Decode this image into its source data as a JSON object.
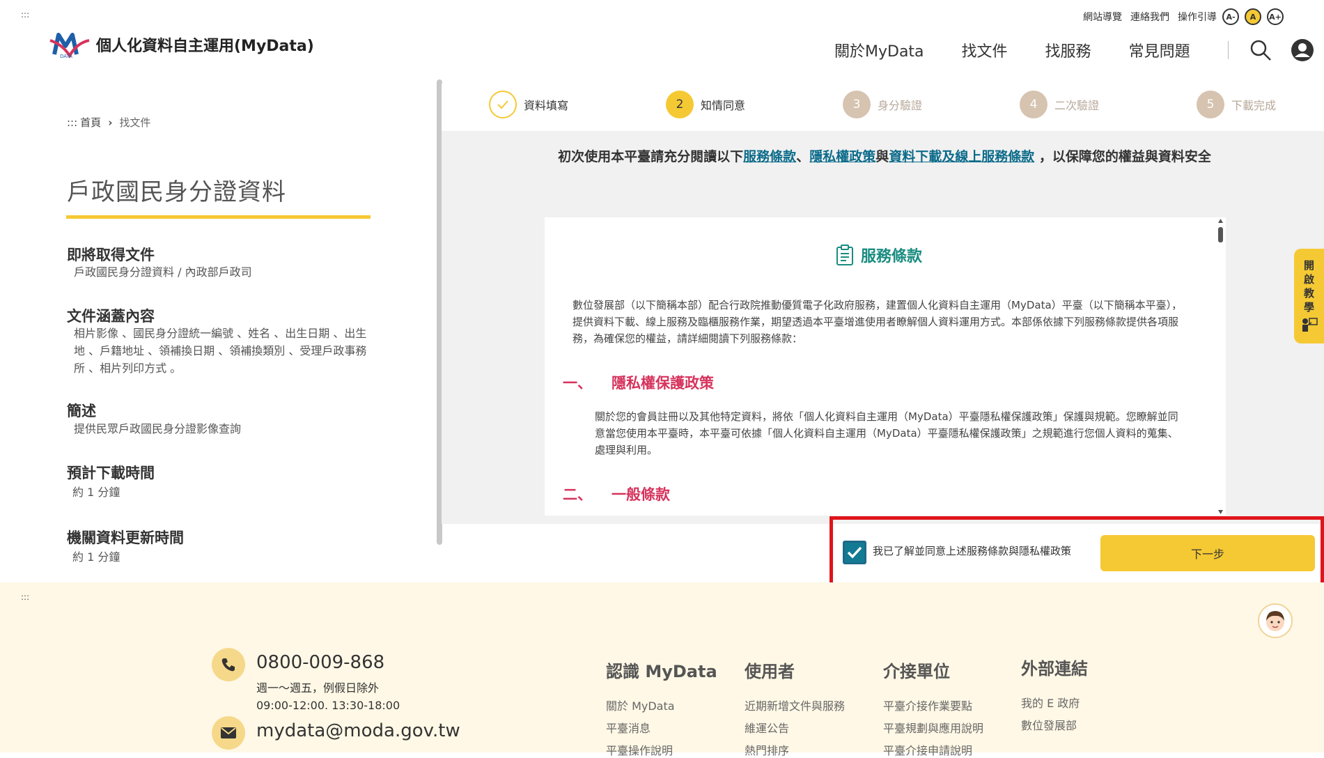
{
  "header": {
    "access_marker": ":::",
    "util_links": [
      "網站導覽",
      "連絡我們",
      "操作引導"
    ],
    "font_sizes": [
      "A-",
      "A",
      "A+"
    ],
    "logo_title": "個人化資料自主運用(MyData)",
    "nav": [
      "關於MyData",
      "找文件",
      "找服務",
      "常見問題"
    ]
  },
  "breadcrumb": {
    "marker": ":::",
    "home": "首頁",
    "sep": "›",
    "current": "找文件"
  },
  "document": {
    "title": "戶政國民身分證資料",
    "sections": [
      {
        "heading": "即將取得文件",
        "text": "戶政國民身分證資料 / 內政部戶政司"
      },
      {
        "heading": "文件涵蓋內容",
        "text": "相片影像 、國民身分證統一編號 、姓名 、出生日期 、出生地 、戶籍地址 、領補換日期 、領補換類別 、受理戶政事務所 、相片列印方式 。"
      },
      {
        "heading": "簡述",
        "text": "提供民眾戶政國民身分證影像查詢"
      },
      {
        "heading": "預計下載時間",
        "text": "約 1 分鐘"
      },
      {
        "heading": "機關資料更新時間",
        "text": "約 1  分鐘"
      }
    ]
  },
  "steps": [
    {
      "num": "✓",
      "label": "資料填寫",
      "state": "done"
    },
    {
      "num": "2",
      "label": "知情同意",
      "state": "active"
    },
    {
      "num": "3",
      "label": "身分驗證",
      "state": "pending"
    },
    {
      "num": "4",
      "label": "二次驗證",
      "state": "pending"
    },
    {
      "num": "5",
      "label": "下載完成",
      "state": "pending"
    }
  ],
  "intro": {
    "prefix": "初次使用本平臺請充分閱讀以下",
    "link1": "服務條款",
    "sep1": "、",
    "link2": "隱私權政策",
    "sep2": "與",
    "link3": "資料下載及線上服務條款",
    "suffix": " ，以保障您的權益與資料安全"
  },
  "terms": {
    "heading": "服務條款",
    "paragraph": "數位發展部（以下簡稱本部）配合行政院推動優質電子化政府服務，建置個人化資料自主運用（MyData）平臺（以下簡稱本平臺），提供資料下載、線上服務及臨櫃服務作業，期望透過本平臺增進使用者瞭解個人資料運用方式。本部係依據下列服務條款提供各項服務，為確保您的權益，請詳細閱讀下列服務條款：",
    "section1_num": "一、",
    "section1_title": "隱私權保護政策",
    "section1_text": "關於您的會員註冊以及其他特定資料，將依「個人化資料自主運用（MyData）平臺隱私權保護政策」保護與規範。您瞭解並同意當您使用本平臺時，本平臺可依據「個人化資料自主運用（MyData）平臺隱私權保護政策」之規範進行您個人資料的蒐集、處理與利用。",
    "section2_num": "二、",
    "section2_title": "一般條款"
  },
  "agree": {
    "checked": true,
    "label": "我已了解並同意上述服務條款與隱私權政策",
    "next_button": "下一步"
  },
  "tutorial_tab": [
    "開",
    "啟",
    "教",
    "學"
  ],
  "footer": {
    "marker": ":::",
    "phone": "0800-009-868",
    "hours_line1": "週一～週五，例假日除外",
    "hours_line2": "09:00-12:00. 13:30-18:00",
    "email": "mydata@moda.gov.tw",
    "columns": [
      {
        "title": "認識 MyData",
        "links": [
          "關於 MyData",
          "平臺消息",
          "平臺操作說明"
        ]
      },
      {
        "title": "使用者",
        "links": [
          "近期新增文件與服務",
          "維運公告",
          "熱門排序"
        ]
      },
      {
        "title": "介接單位",
        "links": [
          "平臺介接作業要點",
          "平臺規劃與應用說明",
          "平臺介接申請說明"
        ]
      },
      {
        "title": "外部連結",
        "links": [
          "我的 E 政府",
          "數位發展部"
        ]
      }
    ]
  },
  "colors": {
    "accent_yellow": "#f5c934",
    "teal": "#1a8c80",
    "link": "#0b6b8a",
    "section_red": "#d6335c",
    "highlight_red": "#e0141b",
    "footer_bg": "#fff8e6"
  }
}
